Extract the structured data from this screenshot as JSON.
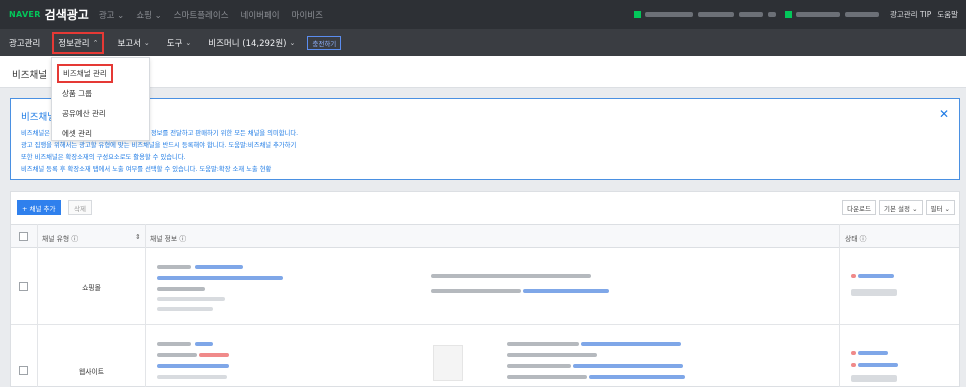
{
  "topbar": {
    "logo_naver": "NAVER",
    "logo_brand": "검색광고",
    "links": [
      "광고 ⌄",
      "쇼핑 ⌄",
      "스마트플레이스",
      "네이버페이",
      "마이비즈"
    ],
    "tip": "광고관리 TIP",
    "help": "도움말"
  },
  "nav": {
    "items": [
      {
        "label": "광고관리",
        "chev": ""
      },
      {
        "label": "정보관리",
        "chev": "⌃"
      },
      {
        "label": "보고서",
        "chev": "⌄"
      },
      {
        "label": "도구",
        "chev": "⌄"
      },
      {
        "label": "비즈머니 (14,292원)",
        "chev": "⌄"
      }
    ],
    "new_label": "충전하기"
  },
  "page": {
    "title": "비즈채널"
  },
  "dropdown": {
    "items": [
      "비즈채널 관리",
      "상품 그룹",
      "공유예산 관리",
      "에셋 관리"
    ]
  },
  "info": {
    "title": "비즈채널",
    "lines": [
      "비즈채널은                              웨이버 예약 등 잠재적 고객에게 상품 정보를 전달하고 판매하기 위한 모든 채널을 의미합니다.",
      "광고 집행을 위해서는 광고할 유형에 맞는 비즈채널을 반드시 등록해야 합니다. 도움말:비즈채널 추가하기",
      "또한 비즈채널은 확장소재의 구성요소로도 활용할 수 있습니다.",
      "비즈채널 등록 후 확장소재 탭에서 노출 여부를 선택할 수 있습니다. 도움말:확장 소재 노출 현황"
    ],
    "close": "✕"
  },
  "toolbar": {
    "add_label": "+ 채널 추가",
    "delete_label": "삭제",
    "download_label": "다운로드",
    "settings_label": "기본 설정 ⌄",
    "filter_label": "필터 ⌄"
  },
  "table": {
    "headers": {
      "type": "채널 유형 ⓘ",
      "info": "채널 정보 ⓘ",
      "status": "상태 ⓘ",
      "sort": "⇕"
    },
    "rows": [
      {
        "type": "쇼핑몰"
      },
      {
        "type": "웹사이트"
      }
    ]
  },
  "colors": {
    "topbar_bg": "#2d3035",
    "navbar_bg": "#3a3d42",
    "accent_green": "#03c75a",
    "accent_blue": "#2f80ed",
    "highlight_red": "#e53935"
  }
}
